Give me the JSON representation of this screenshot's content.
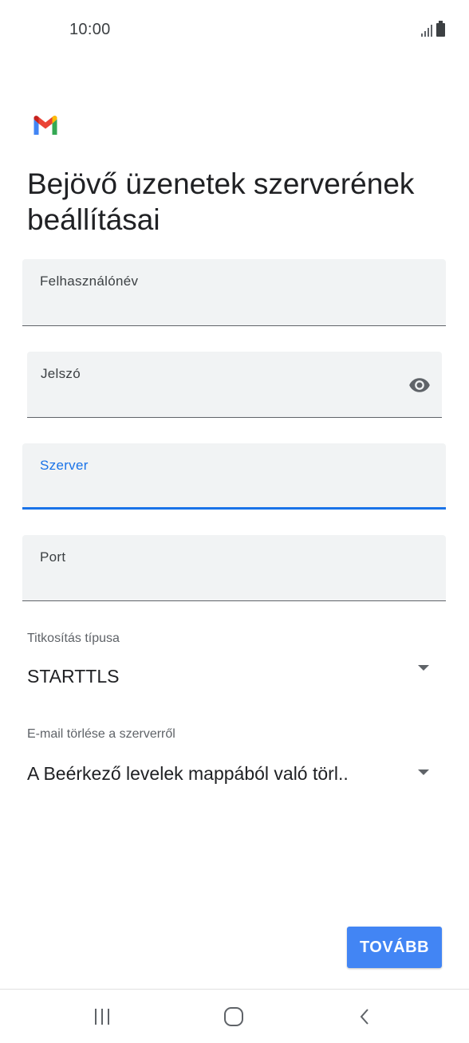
{
  "status_bar": {
    "time": "10:00",
    "icons": [
      "signal-icon",
      "battery-icon"
    ]
  },
  "app": {
    "logo": "gmail-logo",
    "title": "Bejövő üzenetek szerverének beállításai"
  },
  "fields": {
    "username": {
      "label": "Felhasználónév",
      "value": ""
    },
    "password": {
      "label": "Jelszó",
      "value": "",
      "toggle_icon": "eye-icon"
    },
    "server": {
      "label": "Szerver",
      "value": "",
      "focused": true
    },
    "port": {
      "label": "Port",
      "value": ""
    }
  },
  "encryption": {
    "label": "Titkosítás típusa",
    "value": "STARTTLS"
  },
  "delete_from_server": {
    "label": "E-mail törlése a szerverről",
    "value": "A Beérkező levelek mappából való törl.."
  },
  "actions": {
    "next_label": "TOVÁBB"
  },
  "colors": {
    "accent": "#1a73e8",
    "button": "#4285f4",
    "field_bg": "#f1f3f4"
  },
  "navigation": {
    "icons": [
      "recent-apps-icon",
      "home-icon",
      "back-icon"
    ]
  }
}
